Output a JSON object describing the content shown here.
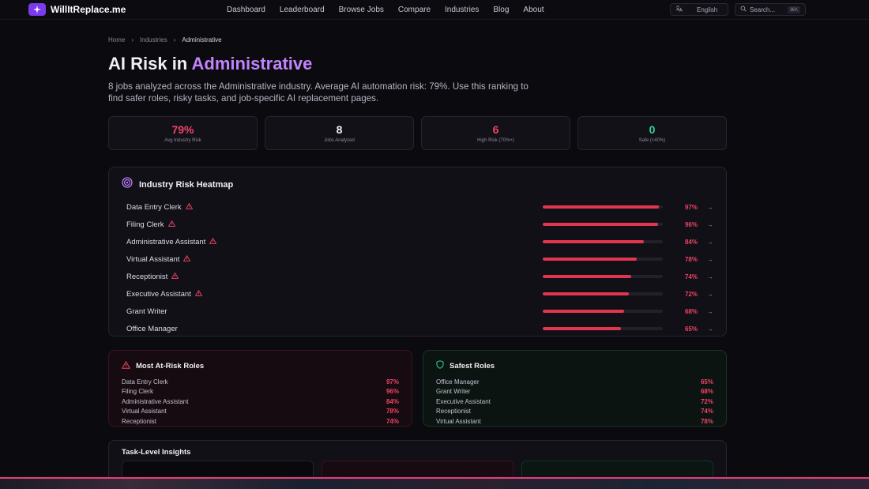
{
  "brand": {
    "name": "WillItReplace.me"
  },
  "nav": {
    "items": [
      "Dashboard",
      "Leaderboard",
      "Browse Jobs",
      "Compare",
      "Industries",
      "Blog",
      "About"
    ]
  },
  "header_right": {
    "language": "English",
    "search_label": "Search...",
    "search_shortcut": "⌘K"
  },
  "breadcrumb": [
    "Home",
    "Industries",
    "Administrative"
  ],
  "page": {
    "title_prefix": "AI Risk in ",
    "title_accent": "Administrative",
    "subtitle": "8 jobs analyzed across the Administrative industry. Average AI automation risk: 79%. Use this ranking to find safer roles, risky tasks, and job-specific AI replacement pages."
  },
  "stats": [
    {
      "value": "79%",
      "label": "Avg Industry Risk",
      "tone": "red"
    },
    {
      "value": "8",
      "label": "Jobs Analyzed",
      "tone": "white"
    },
    {
      "value": "6",
      "label": "High Risk (70%+)",
      "tone": "red"
    },
    {
      "value": "0",
      "label": "Safe (<40%)",
      "tone": "green"
    }
  ],
  "heatmap": {
    "title": "Industry Risk Heatmap",
    "rows": [
      {
        "name": "Data Entry Clerk",
        "pct": "97%",
        "value": 97,
        "warn": true
      },
      {
        "name": "Filing Clerk",
        "pct": "96%",
        "value": 96,
        "warn": true
      },
      {
        "name": "Administrative Assistant",
        "pct": "84%",
        "value": 84,
        "warn": true
      },
      {
        "name": "Virtual Assistant",
        "pct": "78%",
        "value": 78,
        "warn": true
      },
      {
        "name": "Receptionist",
        "pct": "74%",
        "value": 74,
        "warn": true
      },
      {
        "name": "Executive Assistant",
        "pct": "72%",
        "value": 72,
        "warn": true
      },
      {
        "name": "Grant Writer",
        "pct": "68%",
        "value": 68,
        "warn": false
      },
      {
        "name": "Office Manager",
        "pct": "65%",
        "value": 65,
        "warn": false
      }
    ]
  },
  "at_risk": {
    "title": "Most At-Risk Roles",
    "rows": [
      {
        "name": "Data Entry Clerk",
        "pct": "97%"
      },
      {
        "name": "Filing Clerk",
        "pct": "96%"
      },
      {
        "name": "Administrative Assistant",
        "pct": "84%"
      },
      {
        "name": "Virtual Assistant",
        "pct": "78%"
      },
      {
        "name": "Receptionist",
        "pct": "74%"
      }
    ]
  },
  "safest": {
    "title": "Safest Roles",
    "rows": [
      {
        "name": "Office Manager",
        "pct": "65%"
      },
      {
        "name": "Grant Writer",
        "pct": "68%"
      },
      {
        "name": "Executive Assistant",
        "pct": "72%"
      },
      {
        "name": "Receptionist",
        "pct": "74%"
      },
      {
        "name": "Virtual Assistant",
        "pct": "78%"
      }
    ]
  },
  "task_insights": {
    "title": "Task-Level Insights"
  },
  "colors": {
    "accent": "#c084fc",
    "brand": "#7c3aed",
    "risk": "#ef4466",
    "bar": "#e2364f",
    "safe": "#34d399"
  }
}
